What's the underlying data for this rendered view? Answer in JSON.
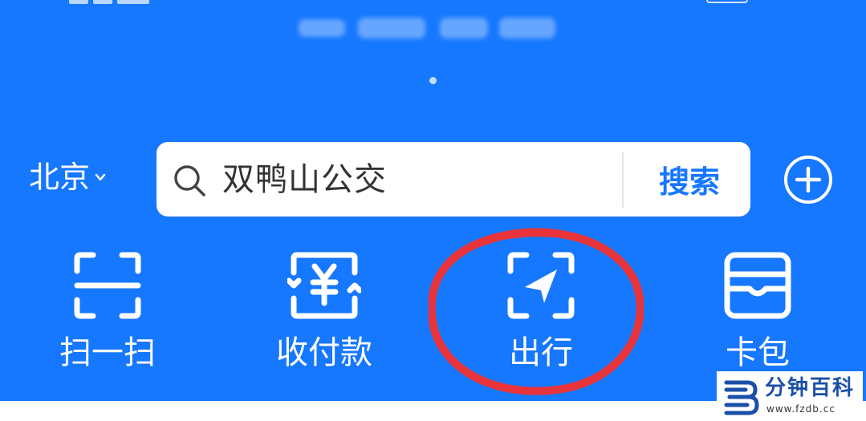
{
  "header": {
    "city": "北京",
    "brand_color": "#1677ff"
  },
  "search": {
    "placeholder": "双鸭山公交",
    "button_label": "搜索"
  },
  "actions": [
    {
      "label": "扫一扫",
      "icon": "scan-icon"
    },
    {
      "label": "收付款",
      "icon": "yuan-payment-icon"
    },
    {
      "label": "出行",
      "icon": "travel-navigation-icon"
    },
    {
      "label": "卡包",
      "icon": "wallet-icon"
    }
  ],
  "annotation": {
    "highlight_color": "#e8343a",
    "highlight_target": "出行"
  },
  "watermark": {
    "name": "分钟百科",
    "url": "www.fzdb.cc"
  }
}
